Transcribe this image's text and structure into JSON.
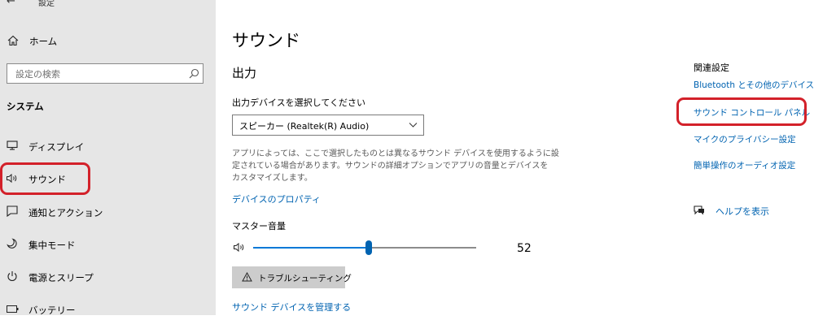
{
  "window": {
    "title": "設定",
    "minimize_glyph": "–"
  },
  "sidebar": {
    "back_glyph": "←",
    "home_label": "ホーム",
    "search_placeholder": "設定の検索",
    "section_title": "システム",
    "items": [
      {
        "label": "ディスプレイ",
        "icon": "display-icon"
      },
      {
        "label": "サウンド",
        "icon": "speaker-icon",
        "selected": true
      },
      {
        "label": "通知とアクション",
        "icon": "notification-icon"
      },
      {
        "label": "集中モード",
        "icon": "moon-icon"
      },
      {
        "label": "電源とスリープ",
        "icon": "power-icon"
      },
      {
        "label": "バッテリー",
        "icon": "battery-icon"
      }
    ]
  },
  "main": {
    "page_title": "サウンド",
    "output_heading": "出力",
    "device_prompt": "出力デバイスを選択してください",
    "device_selected": "スピーカー (Realtek(R) Audio)",
    "description_line1": "アプリによっては、ここで選択したものとは異なるサウンド デバイスを使用するように設",
    "description_line2": "定されている場合があります。サウンドの詳細オプションでアプリの音量とデバイスを",
    "description_line3": "カスタマイズします。",
    "device_properties_link": "デバイスのプロパティ",
    "master_volume_label": "マスター音量",
    "volume_value": 52,
    "volume_value_text": "52",
    "troubleshoot_label": "トラブルシューティング",
    "manage_devices_link": "サウンド デバイスを管理する"
  },
  "related": {
    "heading": "関連設定",
    "links": [
      "Bluetooth とその他のデバイス",
      "サウンド コントロール パネル",
      "マイクのプライバシー設定",
      "簡単操作のオーディオ設定"
    ],
    "help_label": "ヘルプを表示"
  },
  "colors": {
    "accent": "#0063b1",
    "highlight": "#d3212a",
    "sidebar_bg": "#e6e6e6"
  }
}
